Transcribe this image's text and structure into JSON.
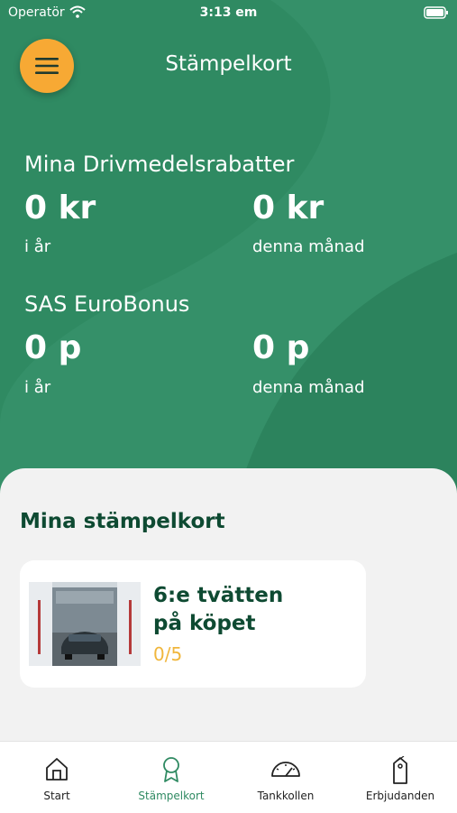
{
  "status_bar": {
    "carrier": "Operatör",
    "time": "3:13 em"
  },
  "header": {
    "title": "Stämpelkort"
  },
  "discounts": {
    "title": "Mina Drivmedelsrabatter",
    "year_value": "0 kr",
    "year_label": "i år",
    "month_value": "0 kr",
    "month_label": "denna månad"
  },
  "eurobonus": {
    "title": "SAS EuroBonus",
    "year_value": "0 p",
    "year_label": "i år",
    "month_value": "0 p",
    "month_label": "denna månad"
  },
  "stamp_cards": {
    "title": "Mina stämpelkort",
    "cards": [
      {
        "name_line1": "6:e tvätten",
        "name_line2": "på köpet",
        "progress": "0/5"
      }
    ]
  },
  "tabbar": {
    "tabs": [
      {
        "label": "Start",
        "icon": "home-icon"
      },
      {
        "label": "Stämpelkort",
        "icon": "badge-icon",
        "active": true
      },
      {
        "label": "Tankkollen",
        "icon": "gauge-icon"
      },
      {
        "label": "Erbjudanden",
        "icon": "tags-icon"
      }
    ]
  },
  "colors": {
    "brand_green": "#2f8a62",
    "dark_green": "#0e4a32",
    "accent_orange": "#f7a934",
    "progress_yellow": "#f0b63c"
  }
}
